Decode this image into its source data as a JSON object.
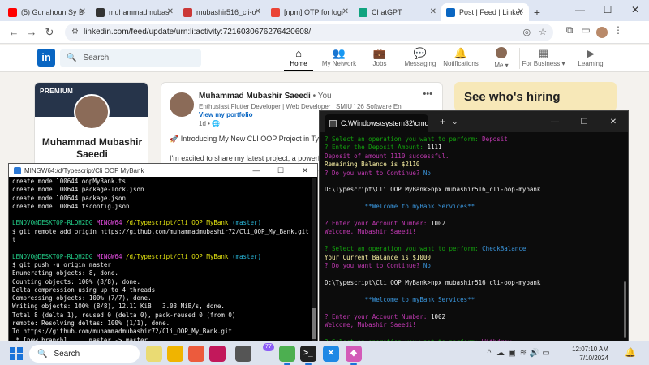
{
  "browser": {
    "tabs": [
      {
        "title": "(5) Gunahoun Sy Ba",
        "color": "#ff0000"
      },
      {
        "title": "muhammadmubas",
        "color": "#333333"
      },
      {
        "title": "mubashir516_cli-o",
        "color": "#cb3837"
      },
      {
        "title": "[npm] OTP for logi",
        "color": "#ea4335"
      },
      {
        "title": "ChatGPT",
        "color": "#10a37f"
      },
      {
        "title": "Post | Feed | Linkedi",
        "color": "#0a66c2"
      }
    ],
    "new_tab": "+",
    "url": "linkedin.com/feed/update/urn:li:activity:7216030676276420608/"
  },
  "linkedin": {
    "search_placeholder": "Search",
    "nav": [
      {
        "label": "Home",
        "icon": "home-icon",
        "glyph": "⌂"
      },
      {
        "label": "My Network",
        "icon": "network-icon",
        "glyph": "👥"
      },
      {
        "label": "Jobs",
        "icon": "jobs-icon",
        "glyph": "💼"
      },
      {
        "label": "Messaging",
        "icon": "messaging-icon",
        "glyph": "💬"
      },
      {
        "label": "Notifications",
        "icon": "bell-icon",
        "glyph": "🔔"
      },
      {
        "label": "Me ▾",
        "icon": "me-avatar",
        "glyph": ""
      },
      {
        "label": "For Business ▾",
        "icon": "grid-icon",
        "glyph": "▦"
      },
      {
        "label": "Learning",
        "icon": "learning-icon",
        "glyph": "▶"
      }
    ],
    "profile": {
      "banner": "PREMIUM",
      "name": "Muhammad Mubashir Saeedi"
    },
    "post": {
      "author": "Muhammad Mubashir Saeedi",
      "you": " • You",
      "headline": "Enthusiast Flutter Developer | Web Developer | SMIU ' 26 Software Engi...",
      "link": "View my portfolio",
      "time": "1d • 🌐",
      "line1": "🚀 Introducing My New CLI OOP Project in TypeScript",
      "line2": "I'm excited to share my latest project, a powerful"
    },
    "ad": {
      "text": "See who's hiring"
    }
  },
  "bash": {
    "title": "MINGW64:/d/Typescript/Cli OOP MyBank",
    "lines": [
      {
        "parts": [
          {
            "t": "create mode 100644 oopMyBank.ts",
            "c": "w"
          }
        ]
      },
      {
        "parts": [
          {
            "t": "create mode 100644 package-lock.json",
            "c": "w"
          }
        ]
      },
      {
        "parts": [
          {
            "t": "create mode 100644 package.json",
            "c": "w"
          }
        ]
      },
      {
        "parts": [
          {
            "t": "create mode 100644 tsconfig.json",
            "c": "w"
          }
        ]
      },
      {
        "parts": [
          {
            "t": " ",
            "c": "w"
          }
        ]
      },
      {
        "parts": [
          {
            "t": "LENOVO@DESKTOP-RLQH2DG ",
            "c": "g"
          },
          {
            "t": "MINGW64 ",
            "c": "m"
          },
          {
            "t": "/d/Typescript/Cli OOP MyBank ",
            "c": "y"
          },
          {
            "t": "(master)",
            "c": "c"
          }
        ]
      },
      {
        "parts": [
          {
            "t": "$ git remote add origin https://github.com/muhammadmubashir72/Cli_OOP_My_Bank.git",
            "c": "w"
          }
        ]
      },
      {
        "parts": [
          {
            "t": "t",
            "c": "w"
          }
        ]
      },
      {
        "parts": [
          {
            "t": " ",
            "c": "w"
          }
        ]
      },
      {
        "parts": [
          {
            "t": "LENOVO@DESKTOP-RLQH2DG ",
            "c": "g"
          },
          {
            "t": "MINGW64 ",
            "c": "m"
          },
          {
            "t": "/d/Typescript/Cli OOP MyBank ",
            "c": "y"
          },
          {
            "t": "(master)",
            "c": "c"
          }
        ]
      },
      {
        "parts": [
          {
            "t": "$ git push -u origin master",
            "c": "w"
          }
        ]
      },
      {
        "parts": [
          {
            "t": "Enumerating objects: 8, done.",
            "c": "w"
          }
        ]
      },
      {
        "parts": [
          {
            "t": "Counting objects: 100% (8/8), done.",
            "c": "w"
          }
        ]
      },
      {
        "parts": [
          {
            "t": "Delta compression using up to 4 threads",
            "c": "w"
          }
        ]
      },
      {
        "parts": [
          {
            "t": "Compressing objects: 100% (7/7), done.",
            "c": "w"
          }
        ]
      },
      {
        "parts": [
          {
            "t": "Writing objects: 100% (8/8), 12.11 KiB | 3.03 MiB/s, done.",
            "c": "w"
          }
        ]
      },
      {
        "parts": [
          {
            "t": "Total 8 (delta 1), reused 0 (delta 0), pack-reused 0 (from 0)",
            "c": "w"
          }
        ]
      },
      {
        "parts": [
          {
            "t": "remote: Resolving deltas: 100% (1/1), done.",
            "c": "w"
          }
        ]
      },
      {
        "parts": [
          {
            "t": "To https://github.com/muhammadmubashir72/Cli_OOP_My_Bank.git",
            "c": "w"
          }
        ]
      },
      {
        "parts": [
          {
            "t": " * [new branch]      master -> master",
            "c": "w"
          }
        ]
      },
      {
        "parts": [
          {
            "t": "branch 'master' set up to track 'origin/master'.",
            "c": "w"
          }
        ]
      },
      {
        "parts": [
          {
            "t": " ",
            "c": "w"
          }
        ]
      },
      {
        "parts": [
          {
            "t": "LENOVO@DESKTOP-RLQH2DG ",
            "c": "g"
          },
          {
            "t": "MINGW64 ",
            "c": "m"
          },
          {
            "t": "/d/Typescript/Cli OOP MyBank ",
            "c": "y"
          },
          {
            "t": "(master)",
            "c": "c"
          }
        ]
      },
      {
        "parts": [
          {
            "t": "$ ",
            "c": "w"
          }
        ]
      }
    ]
  },
  "cmd": {
    "tab_title": "C:\\Windows\\system32\\cmd.e",
    "lines": [
      {
        "parts": [
          {
            "t": "? Select an operation you want to perform: ",
            "c": "cg"
          },
          {
            "t": "Deposit",
            "c": "cm"
          }
        ]
      },
      {
        "parts": [
          {
            "t": "? Enter the Deposit Amount: ",
            "c": "cg"
          },
          {
            "t": "1111",
            "c": "w"
          }
        ]
      },
      {
        "parts": [
          {
            "t": "Deposit of amount 1110 successful.",
            "c": "cm"
          }
        ]
      },
      {
        "parts": [
          {
            "t": "Remaining Balance is $2110",
            "c": "cy"
          }
        ]
      },
      {
        "parts": [
          {
            "t": "? Do you want to Continue? ",
            "c": "cm"
          },
          {
            "t": "No",
            "c": "cc"
          }
        ]
      },
      {
        "parts": [
          {
            "t": " ",
            "c": "w"
          }
        ]
      },
      {
        "parts": [
          {
            "t": "D:\\Typescript\\Cli OOP MyBank>npx mubashir516_cli-oop-mybank",
            "c": "w"
          }
        ]
      },
      {
        "parts": [
          {
            "t": " ",
            "c": "w"
          }
        ]
      },
      {
        "parts": [
          {
            "t": "           **Welcome to myBank Services**",
            "c": "cc"
          }
        ]
      },
      {
        "parts": [
          {
            "t": " ",
            "c": "w"
          }
        ]
      },
      {
        "parts": [
          {
            "t": "? Enter your Account Number: ",
            "c": "cm"
          },
          {
            "t": "1002",
            "c": "w"
          }
        ]
      },
      {
        "parts": [
          {
            "t": "Welcome, Mubashir Saeedi!",
            "c": "cm"
          }
        ]
      },
      {
        "parts": [
          {
            "t": " ",
            "c": "w"
          }
        ]
      },
      {
        "parts": [
          {
            "t": "? Select an operation you want to perform: ",
            "c": "cg"
          },
          {
            "t": "CheckBalance",
            "c": "cc"
          }
        ]
      },
      {
        "parts": [
          {
            "t": "Your Current Balance is $1000",
            "c": "cy"
          }
        ]
      },
      {
        "parts": [
          {
            "t": "? Do you want to Continue? ",
            "c": "cm"
          },
          {
            "t": "No",
            "c": "cc"
          }
        ]
      },
      {
        "parts": [
          {
            "t": " ",
            "c": "w"
          }
        ]
      },
      {
        "parts": [
          {
            "t": "D:\\Typescript\\Cli OOP MyBank>npx mubashir516_cli-oop-mybank",
            "c": "w"
          }
        ]
      },
      {
        "parts": [
          {
            "t": " ",
            "c": "w"
          }
        ]
      },
      {
        "parts": [
          {
            "t": "           **Welcome to myBank Services**",
            "c": "cc"
          }
        ]
      },
      {
        "parts": [
          {
            "t": " ",
            "c": "w"
          }
        ]
      },
      {
        "parts": [
          {
            "t": "? Enter your Account Number: ",
            "c": "cm"
          },
          {
            "t": "1002",
            "c": "w"
          }
        ]
      },
      {
        "parts": [
          {
            "t": "Welcome, Mubashir Saeedi!",
            "c": "cm"
          }
        ]
      },
      {
        "parts": [
          {
            "t": " ",
            "c": "w"
          }
        ]
      },
      {
        "parts": [
          {
            "t": "? Select an operation you want to perform: ",
            "c": "cg"
          },
          {
            "t": "Withdraw",
            "c": "cm"
          }
        ]
      },
      {
        "parts": [
          {
            "t": "? Enter the Withdraw Amount: ",
            "c": "cg"
          },
          {
            "t": "500",
            "c": "w"
          }
        ]
      },
      {
        "parts": [
          {
            "t": "Withdrawal of 500 successful.",
            "c": "cg"
          }
        ]
      },
      {
        "parts": [
          {
            "t": "Remaining balance is $500.",
            "c": "cg"
          }
        ]
      },
      {
        "parts": [
          {
            "t": "? Do you want to Continue? ",
            "c": "cm"
          },
          {
            "t": "(y/N)",
            "c": "w"
          }
        ]
      }
    ]
  },
  "taskbar": {
    "search": "Search",
    "badge": "77",
    "time": "12:07:10 AM",
    "date": "7/10/2024"
  }
}
